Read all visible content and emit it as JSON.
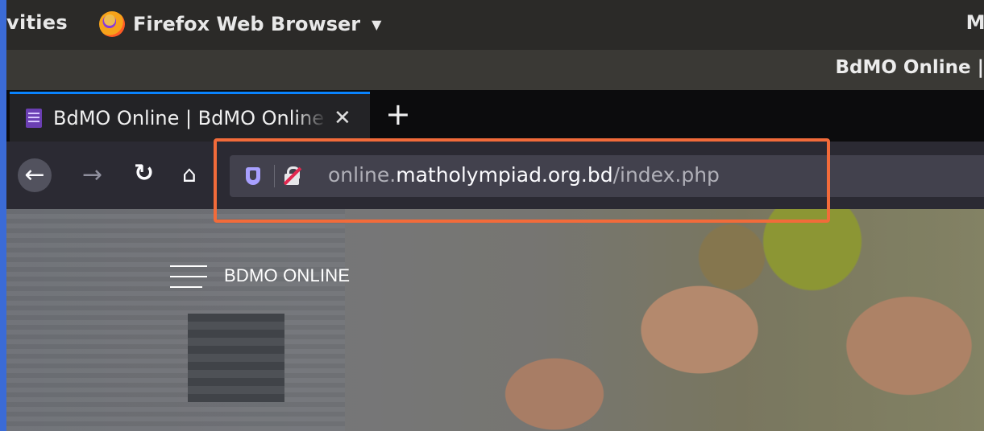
{
  "topbar": {
    "activities": "vities",
    "app_name": "Firefox Web Browser",
    "clock": "Mo"
  },
  "window": {
    "title": "BdMO Online |"
  },
  "tabs": [
    {
      "label": "BdMO Online | BdMO Online",
      "active": true
    }
  ],
  "newtab": "+",
  "nav": {
    "url_prefix": "online.",
    "url_domain": "matholympiad.org.bd",
    "url_path": "/index.php"
  },
  "page": {
    "brand": "BDMO ONLINE"
  },
  "colors": {
    "highlight": "#f26b3a",
    "tab_accent": "#0a84ff"
  }
}
